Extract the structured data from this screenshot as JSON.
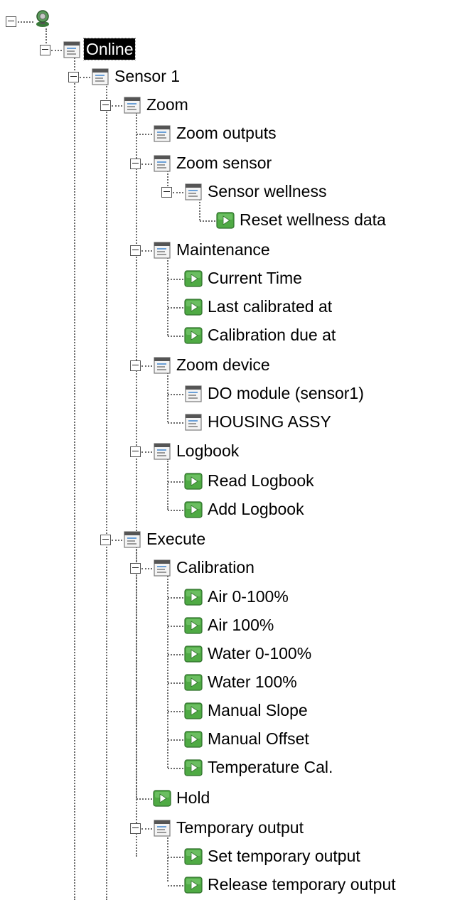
{
  "tree": {
    "root": {
      "icon": "device-icon"
    },
    "nodes": [
      {
        "label": "Online",
        "icon": "menu-icon",
        "selected": true
      },
      {
        "label": "Sensor 1",
        "icon": "menu-icon"
      },
      {
        "label": "Zoom",
        "icon": "menu-icon"
      },
      {
        "label": "Zoom outputs",
        "icon": "menu-icon"
      },
      {
        "label": "Zoom sensor",
        "icon": "menu-icon"
      },
      {
        "label": "Sensor wellness",
        "icon": "menu-icon"
      },
      {
        "label": "Reset wellness data",
        "icon": "method-icon"
      },
      {
        "label": "Maintenance",
        "icon": "menu-icon"
      },
      {
        "label": "Current Time",
        "icon": "method-icon"
      },
      {
        "label": "Last calibrated at",
        "icon": "method-icon"
      },
      {
        "label": "Calibration due at",
        "icon": "method-icon"
      },
      {
        "label": "Zoom device",
        "icon": "menu-icon"
      },
      {
        "label": "DO module (sensor1)",
        "icon": "menu-icon"
      },
      {
        "label": "HOUSING ASSY",
        "icon": "menu-icon"
      },
      {
        "label": "Logbook",
        "icon": "menu-icon"
      },
      {
        "label": "Read Logbook",
        "icon": "method-icon"
      },
      {
        "label": "Add Logbook",
        "icon": "method-icon"
      },
      {
        "label": "Execute",
        "icon": "menu-icon"
      },
      {
        "label": "Calibration",
        "icon": "menu-icon"
      },
      {
        "label": "Air 0-100%",
        "icon": "method-icon"
      },
      {
        "label": "Air 100%",
        "icon": "method-icon"
      },
      {
        "label": "Water 0-100%",
        "icon": "method-icon"
      },
      {
        "label": "Water 100%",
        "icon": "method-icon"
      },
      {
        "label": "Manual Slope",
        "icon": "method-icon"
      },
      {
        "label": "Manual Offset",
        "icon": "method-icon"
      },
      {
        "label": "Temperature Cal.",
        "icon": "method-icon"
      },
      {
        "label": "Hold",
        "icon": "method-icon"
      },
      {
        "label": "Temporary output",
        "icon": "menu-icon"
      },
      {
        "label": "Set temporary output",
        "icon": "method-icon"
      },
      {
        "label": "Release temporary output",
        "icon": "method-icon"
      }
    ]
  }
}
